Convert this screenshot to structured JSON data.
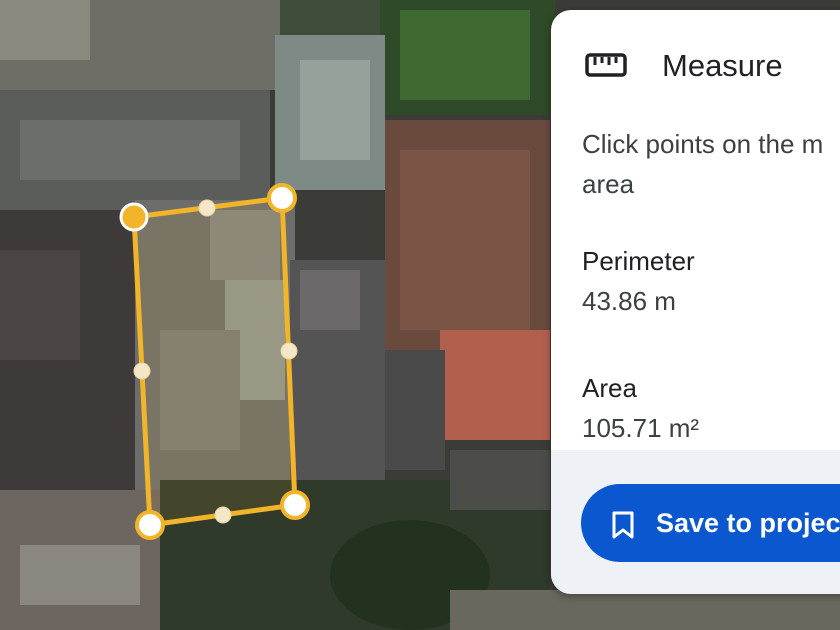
{
  "panel": {
    "icon": "ruler-icon",
    "title": "Measure",
    "instructions_line1": "Click points on the m",
    "instructions_line2": "area",
    "perimeter_label": "Perimeter",
    "perimeter_value": "43.86 m",
    "area_label": "Area",
    "area_value": "105.71 m²",
    "save_icon": "bookmark-icon",
    "save_label": "Save to projec"
  },
  "colors": {
    "polygon_stroke": "#f2b52a",
    "polygon_fill": "rgba(242,181,42,0.10)",
    "active_vertex": "#f2b52a",
    "button_blue": "#0b57d0",
    "panel_footer": "#eef1f6"
  }
}
